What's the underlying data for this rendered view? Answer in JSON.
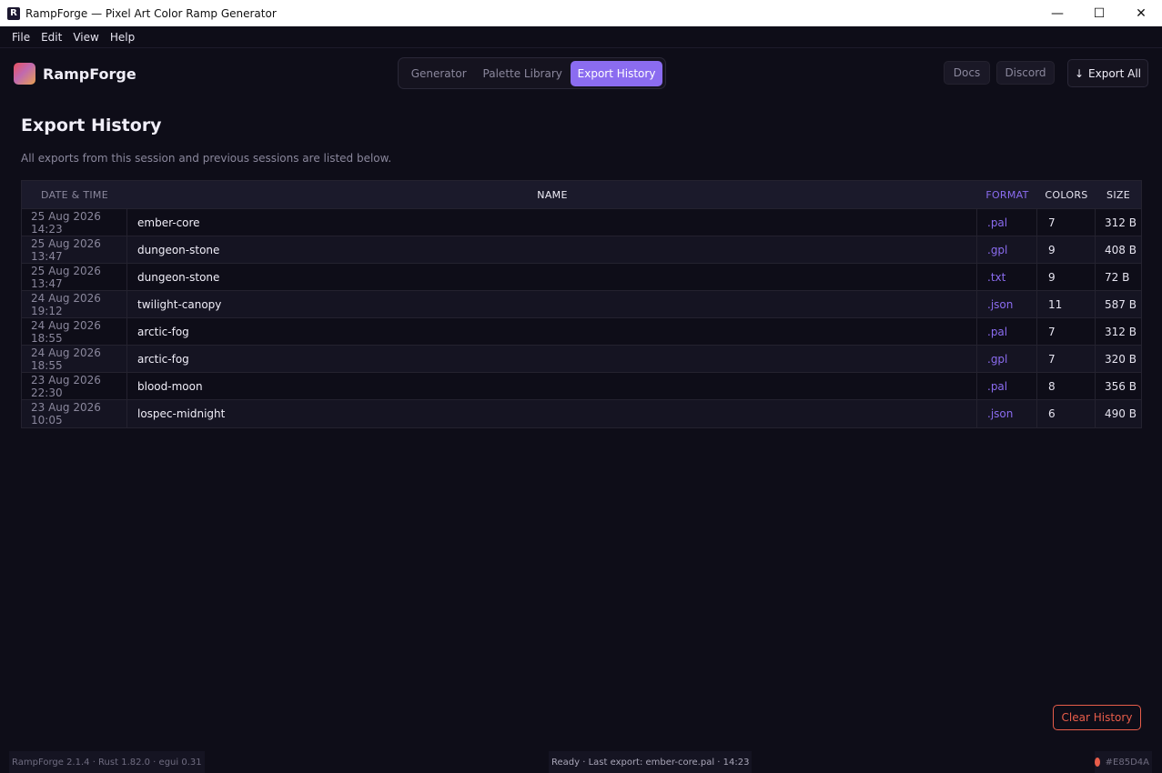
{
  "window": {
    "title": "RampForge — Pixel Art Color Ramp Generator",
    "app_icon_letter": "R",
    "minimize_glyph": "—",
    "maximize_glyph": "☐",
    "close_glyph": "✕"
  },
  "menu": [
    "File",
    "Edit",
    "View",
    "Help"
  ],
  "header": {
    "logo_text": "RampForge",
    "tabs": [
      {
        "label": "Generator",
        "active": false
      },
      {
        "label": "Palette Library",
        "active": false
      },
      {
        "label": "Export History",
        "active": true
      }
    ],
    "docs_label": "Docs",
    "discord_label": "Discord",
    "export_arrow": "↓",
    "export_all_label": "Export All"
  },
  "page": {
    "title": "Export History",
    "subtitle": "All exports from this session and previous sessions are listed below."
  },
  "table": {
    "columns": [
      "DATE & TIME",
      "NAME",
      "FORMAT",
      "COLORS",
      "SIZE"
    ],
    "rows": [
      {
        "date": "25 Aug 2026 14:23",
        "name": "ember-core",
        "format": ".pal",
        "colors": "7",
        "size": "312 B"
      },
      {
        "date": "25 Aug 2026 13:47",
        "name": "dungeon-stone",
        "format": ".gpl",
        "colors": "9",
        "size": "408 B"
      },
      {
        "date": "25 Aug 2026 13:47",
        "name": "dungeon-stone",
        "format": ".txt",
        "colors": "9",
        "size": "72 B"
      },
      {
        "date": "24 Aug 2026 19:12",
        "name": "twilight-canopy",
        "format": ".json",
        "colors": "11",
        "size": "587 B"
      },
      {
        "date": "24 Aug 2026 18:55",
        "name": "arctic-fog",
        "format": ".pal",
        "colors": "7",
        "size": "312 B"
      },
      {
        "date": "24 Aug 2026 18:55",
        "name": "arctic-fog",
        "format": ".gpl",
        "colors": "7",
        "size": "320 B"
      },
      {
        "date": "23 Aug 2026 22:30",
        "name": "blood-moon",
        "format": ".pal",
        "colors": "8",
        "size": "356 B"
      },
      {
        "date": "23 Aug 2026 10:05",
        "name": "lospec-midnight",
        "format": ".json",
        "colors": "6",
        "size": "490 B"
      }
    ]
  },
  "clear_history_label": "Clear History",
  "status": {
    "version": "RampForge 2.1.4 · Rust 1.82.0 · egui 0.31",
    "message": "Ready · Last export: ember-core.pal · 14:23",
    "color_hex": "#E85D4A"
  },
  "colors": {
    "accent": "#8b6cf0",
    "danger": "#e85d4a",
    "background": "#0e0d18"
  }
}
